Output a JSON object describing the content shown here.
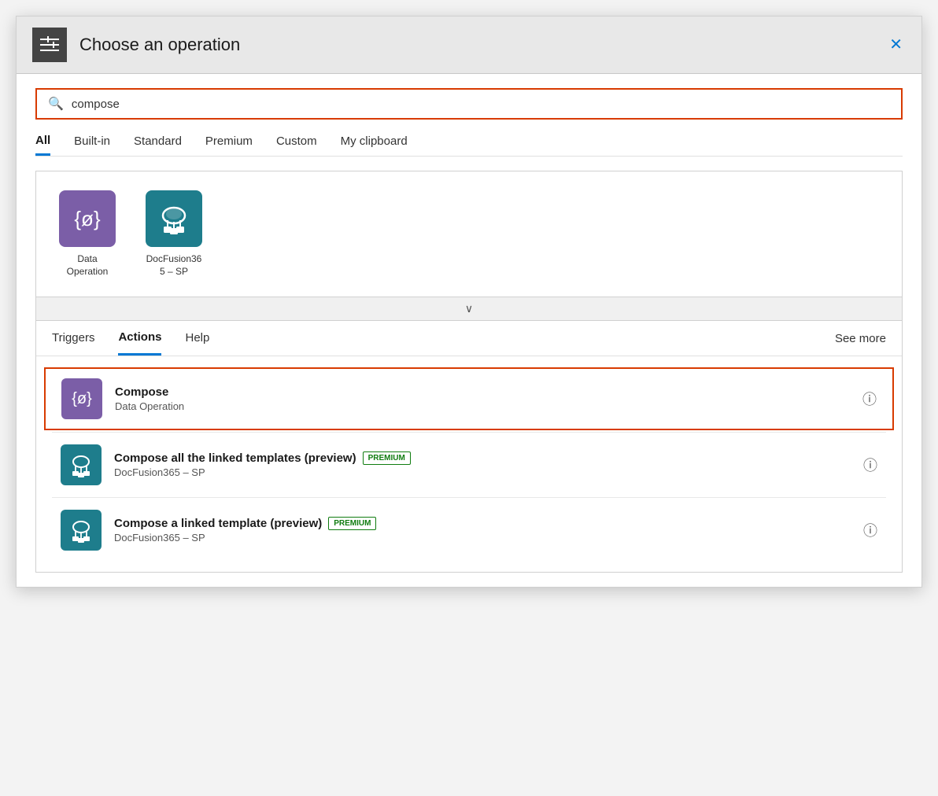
{
  "dialog": {
    "title": "Choose an operation",
    "close_label": "✕"
  },
  "search": {
    "value": "compose",
    "placeholder": "compose"
  },
  "tabs": [
    {
      "label": "All",
      "active": true
    },
    {
      "label": "Built-in",
      "active": false
    },
    {
      "label": "Standard",
      "active": false
    },
    {
      "label": "Premium",
      "active": false
    },
    {
      "label": "Custom",
      "active": false
    },
    {
      "label": "My clipboard",
      "active": false
    }
  ],
  "connectors": [
    {
      "name": "Data Operation",
      "icon_type": "purple",
      "icon_symbol": "{ø}"
    },
    {
      "name": "DocFusion365 – SP",
      "icon_type": "teal",
      "icon_symbol": "☁"
    }
  ],
  "bottom_tabs": [
    {
      "label": "Triggers",
      "active": false
    },
    {
      "label": "Actions",
      "active": true
    },
    {
      "label": "Help",
      "active": false
    }
  ],
  "see_more_label": "See more",
  "actions": [
    {
      "title": "Compose",
      "subtitle": "Data Operation",
      "icon_type": "purple",
      "icon_symbol": "{ø}",
      "selected": true,
      "premium": false
    },
    {
      "title": "Compose all the linked templates (preview)",
      "subtitle": "DocFusion365 – SP",
      "icon_type": "teal",
      "icon_symbol": "☁",
      "selected": false,
      "premium": true
    },
    {
      "title": "Compose a linked template (preview)",
      "subtitle": "DocFusion365 – SP",
      "icon_type": "teal",
      "icon_symbol": "☁",
      "selected": false,
      "premium": true
    }
  ],
  "premium_label": "PREMIUM"
}
